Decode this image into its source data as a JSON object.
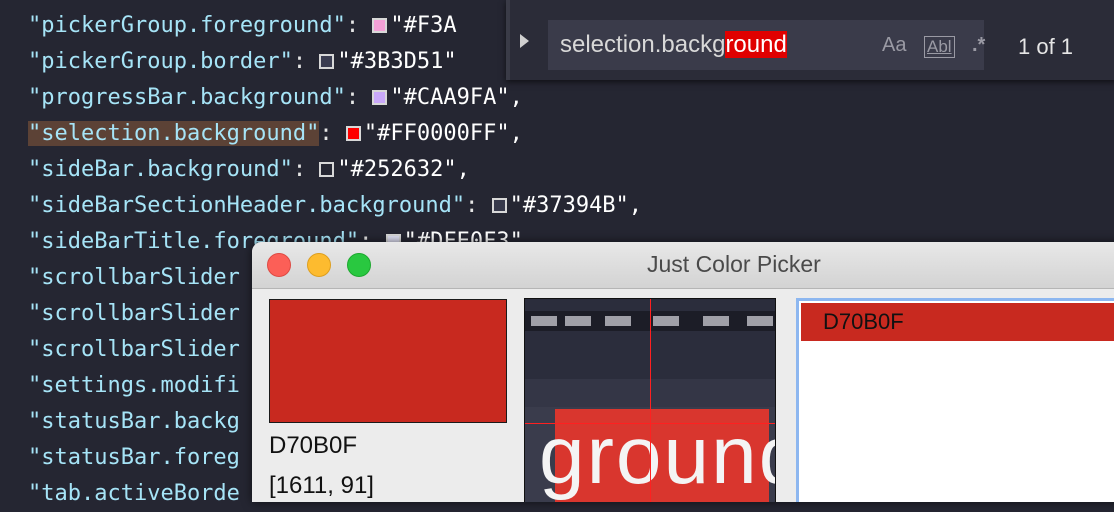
{
  "editor": {
    "lines": [
      {
        "key": "\"pickerGroup.foreground\"",
        "sep": ": ",
        "swatch": "#F3A0D6",
        "value": "\"#F3A"
      },
      {
        "key": "\"pickerGroup.border\"",
        "sep": ": ",
        "swatch": "#3B3D51",
        "value": "\"#3B3D51\""
      },
      {
        "key": "\"progressBar.background\"",
        "sep": ": ",
        "swatch": "#CAA9FA",
        "value": "\"#CAA9FA\","
      },
      {
        "key": "\"selection.background\"",
        "sep": ": ",
        "swatch": "#FF0000",
        "value": "\"#FF0000FF\","
      },
      {
        "key": "\"sideBar.background\"",
        "sep": ": ",
        "swatch": "#252632",
        "value": "\"#252632\","
      },
      {
        "key": "\"sideBarSectionHeader.background\"",
        "sep": ": ",
        "swatch": "#37394B",
        "value": "\"#37394B\","
      },
      {
        "key": "\"sideBarTitle.foreground\"",
        "sep": ": ",
        "swatch": "#DFE0F3",
        "value": "\"#DFE0F3\""
      },
      {
        "key": "\"scrollbarSlider",
        "sep": "",
        "swatch": "",
        "value": ""
      },
      {
        "key": "\"scrollbarSlider",
        "sep": "",
        "swatch": "",
        "value": ""
      },
      {
        "key": "\"scrollbarSlider",
        "sep": "",
        "swatch": "",
        "value": ""
      },
      {
        "key": "\"settings.modifi",
        "sep": "",
        "swatch": "",
        "value": ""
      },
      {
        "key": "\"statusBar.backg",
        "sep": "",
        "swatch": "",
        "value": ""
      },
      {
        "key": "\"statusBar.foreg",
        "sep": "",
        "swatch": "",
        "value": ""
      },
      {
        "key": "\"tab.activeBorde",
        "sep": "",
        "swatch": "",
        "value": ""
      }
    ]
  },
  "find": {
    "query_prefix": "selection.backg",
    "query_match": "round",
    "opt_case": "Aa",
    "opt_word": "Abl",
    "opt_regex": ".*",
    "result_count": "1 of 1"
  },
  "picker": {
    "window_title": "Just Color Picker",
    "hex": "D70B0F",
    "coords": "[1611, 91]",
    "zoom_text": "ground",
    "history": [
      "D70B0F"
    ],
    "colors": {
      "swatch": "#C8291F",
      "accent": "#8DB7F0"
    }
  }
}
